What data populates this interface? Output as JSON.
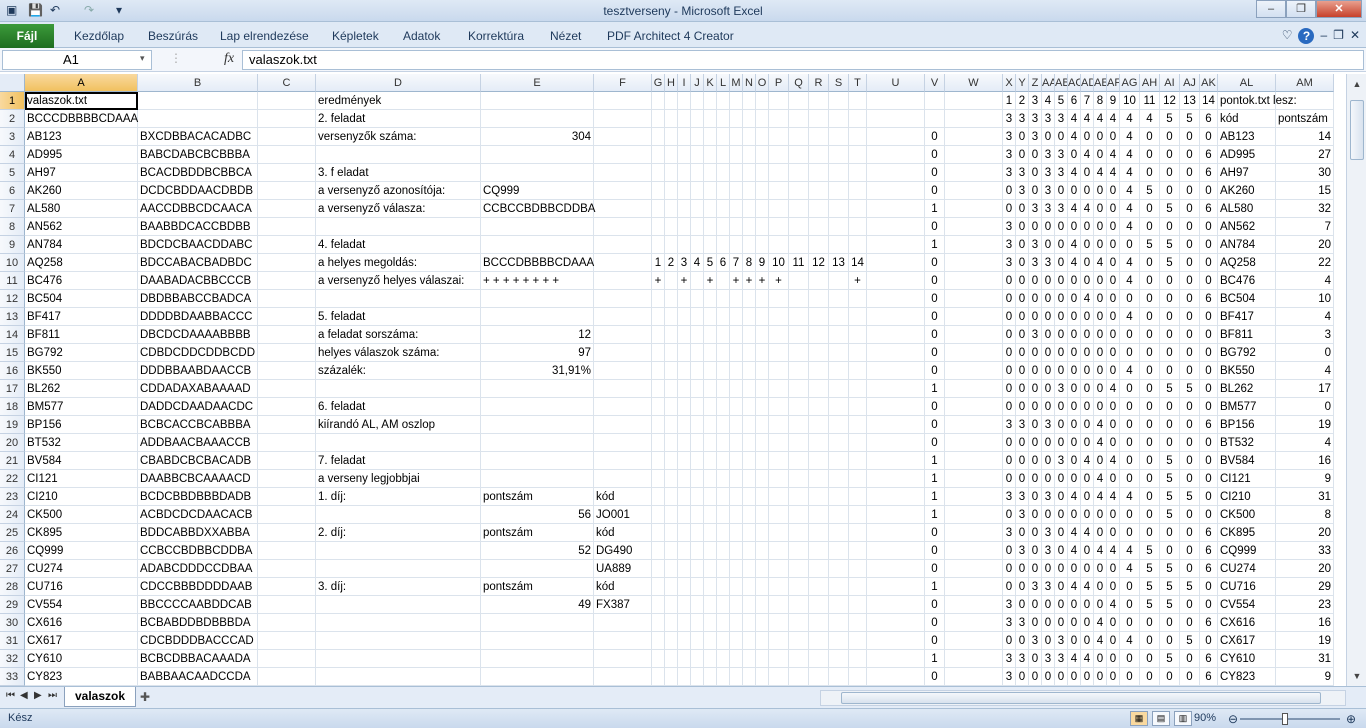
{
  "window": {
    "title": "tesztverseny  -  Microsoft Excel",
    "controls": [
      "–",
      "❐",
      "✕"
    ]
  },
  "ribbon": {
    "file_tab": "Fájl",
    "tabs": [
      "Kezdőlap",
      "Beszúrás",
      "Lap elrendezése",
      "Képletek",
      "Adatok",
      "Korrektúra",
      "Nézet",
      "PDF Architect 4 Creator"
    ]
  },
  "formula_bar": {
    "name_box": "A1",
    "fx_label": "fx",
    "content": "valaszok.txt"
  },
  "columns": [
    "A",
    "B",
    "C",
    "D",
    "E",
    "F",
    "G",
    "H",
    "I",
    "J",
    "K",
    "L",
    "M",
    "N",
    "O",
    "P",
    "Q",
    "R",
    "S",
    "T",
    "U",
    "V",
    "W",
    "X",
    "Y",
    "Z",
    "AA",
    "AB",
    "AC",
    "AD",
    "AE",
    "AF",
    "AG",
    "AH",
    "AI",
    "AJ",
    "AK",
    "AL",
    "AM"
  ],
  "rows": [
    {
      "n": 1,
      "A": "valaszok.txt",
      "D": "eredmények",
      "X": "1",
      "Y": "2",
      "Z": "3",
      "AA": "4",
      "AB": "5",
      "AC": "6",
      "AD": "7",
      "AE": "8",
      "AF": "9",
      "AG": "10",
      "AH": "11",
      "AI": "12",
      "AJ": "13",
      "AK": "14",
      "AL": "pontok.txt lesz:"
    },
    {
      "n": 2,
      "A": "BCCCDBBBBCDAAA",
      "D": "2. feladat",
      "X": "3",
      "Y": "3",
      "Z": "3",
      "AA": "3",
      "AB": "3",
      "AC": "4",
      "AD": "4",
      "AE": "4",
      "AF": "4",
      "AG": "4",
      "AH": "4",
      "AI": "5",
      "AJ": "5",
      "AK": "6",
      "AL": "kód",
      "AM": "pontszám"
    },
    {
      "n": 3,
      "A": "AB123",
      "B": "BXCDBBACACADBC",
      "D": "versenyzők száma:",
      "E": "304",
      "V": "0",
      "X": "3",
      "Y": "0",
      "Z": "3",
      "AA": "0",
      "AB": "0",
      "AC": "4",
      "AD": "0",
      "AE": "0",
      "AF": "0",
      "AG": "4",
      "AH": "0",
      "AI": "0",
      "AJ": "0",
      "AK": "0",
      "AL": "AB123",
      "AM": "14"
    },
    {
      "n": 4,
      "A": "AD995",
      "B": "BABCDABCBCBBBA",
      "V": "0",
      "X": "3",
      "Y": "0",
      "Z": "0",
      "AA": "3",
      "AB": "3",
      "AC": "0",
      "AD": "4",
      "AE": "0",
      "AF": "4",
      "AG": "4",
      "AH": "0",
      "AI": "0",
      "AJ": "0",
      "AK": "6",
      "AL": "AD995",
      "AM": "27"
    },
    {
      "n": 5,
      "A": "AH97",
      "B": "BCACDBDDBCBBCA",
      "D": "3. f eladat",
      "V": "0",
      "X": "3",
      "Y": "3",
      "Z": "0",
      "AA": "3",
      "AB": "3",
      "AC": "4",
      "AD": "0",
      "AE": "4",
      "AF": "4",
      "AG": "4",
      "AH": "0",
      "AI": "0",
      "AJ": "0",
      "AK": "6",
      "AL": "AH97",
      "AM": "30"
    },
    {
      "n": 6,
      "A": "AK260",
      "B": "DCDCBDDAACDBDB",
      "D": "a versenyző azonosítója:",
      "E": "CQ999",
      "V": "0",
      "X": "0",
      "Y": "3",
      "Z": "0",
      "AA": "3",
      "AB": "0",
      "AC": "0",
      "AD": "0",
      "AE": "0",
      "AF": "0",
      "AG": "4",
      "AH": "5",
      "AI": "0",
      "AJ": "0",
      "AK": "0",
      "AL": "AK260",
      "AM": "15"
    },
    {
      "n": 7,
      "A": "AL580",
      "B": "AACCDBBCDCAACA",
      "D": "a versenyző válasza:",
      "E": "CCBCCBDBBCDDBA",
      "V": "1",
      "X": "0",
      "Y": "0",
      "Z": "3",
      "AA": "3",
      "AB": "3",
      "AC": "4",
      "AD": "4",
      "AE": "0",
      "AF": "0",
      "AG": "4",
      "AH": "0",
      "AI": "5",
      "AJ": "0",
      "AK": "6",
      "AL": "AL580",
      "AM": "32"
    },
    {
      "n": 8,
      "A": "AN562",
      "B": "BAABBDCACCBDBB",
      "V": "0",
      "X": "3",
      "Y": "0",
      "Z": "0",
      "AA": "0",
      "AB": "0",
      "AC": "0",
      "AD": "0",
      "AE": "0",
      "AF": "0",
      "AG": "4",
      "AH": "0",
      "AI": "0",
      "AJ": "0",
      "AK": "0",
      "AL": "AN562",
      "AM": "7"
    },
    {
      "n": 9,
      "A": "AN784",
      "B": "BDCDCBAACDDABC",
      "D": "4. feladat",
      "V": "1",
      "X": "3",
      "Y": "0",
      "Z": "3",
      "AA": "0",
      "AB": "0",
      "AC": "4",
      "AD": "0",
      "AE": "0",
      "AF": "0",
      "AG": "0",
      "AH": "5",
      "AI": "5",
      "AJ": "0",
      "AK": "0",
      "AL": "AN784",
      "AM": "20"
    },
    {
      "n": 10,
      "A": "AQ258",
      "B": "BDCCABACBADBDC",
      "D": "a helyes megoldás:",
      "E": "BCCCDBBBBCDAAA",
      "G": "1",
      "H": "2",
      "I": "3",
      "J": "4",
      "K": "5",
      "L": "6",
      "M": "7",
      "N": "8",
      "O": "9",
      "P": "10",
      "Q": "11",
      "R": "12",
      "S": "13",
      "T": "14",
      "V": "0",
      "X": "3",
      "Y": "0",
      "Z": "3",
      "AA": "3",
      "AB": "0",
      "AC": "4",
      "AD": "0",
      "AE": "4",
      "AF": "0",
      "AG": "4",
      "AH": "0",
      "AI": "5",
      "AJ": "0",
      "AK": "0",
      "AL": "AQ258",
      "AM": "22"
    },
    {
      "n": 11,
      "A": "BC476",
      "B": "DAABADACBBCCCB",
      "D": "a versenyző helyes válaszai:",
      "E": " + + + + + + +   +",
      "G": "+",
      "I": "+",
      "K": "+",
      "M": "+",
      "N": "+",
      "O": "+",
      "P": "+",
      "T": "+",
      "V": "0",
      "X": "0",
      "Y": "0",
      "Z": "0",
      "AA": "0",
      "AB": "0",
      "AC": "0",
      "AD": "0",
      "AE": "0",
      "AF": "0",
      "AG": "4",
      "AH": "0",
      "AI": "0",
      "AJ": "0",
      "AK": "0",
      "AL": "BC476",
      "AM": "4"
    },
    {
      "n": 12,
      "A": "BC504",
      "B": "DBDBBABCCBADCA",
      "V": "0",
      "X": "0",
      "Y": "0",
      "Z": "0",
      "AA": "0",
      "AB": "0",
      "AC": "0",
      "AD": "4",
      "AE": "0",
      "AF": "0",
      "AG": "0",
      "AH": "0",
      "AI": "0",
      "AJ": "0",
      "AK": "6",
      "AL": "BC504",
      "AM": "10"
    },
    {
      "n": 13,
      "A": "BF417",
      "B": "DDDDBDAABBACCC",
      "D": "5. feladat",
      "V": "0",
      "X": "0",
      "Y": "0",
      "Z": "0",
      "AA": "0",
      "AB": "0",
      "AC": "0",
      "AD": "0",
      "AE": "0",
      "AF": "0",
      "AG": "4",
      "AH": "0",
      "AI": "0",
      "AJ": "0",
      "AK": "0",
      "AL": "BF417",
      "AM": "4"
    },
    {
      "n": 14,
      "A": "BF811",
      "B": "DBCDCDAAAABBBB",
      "D": "a feladat sorszáma:",
      "E": "12",
      "V": "0",
      "X": "0",
      "Y": "0",
      "Z": "3",
      "AA": "0",
      "AB": "0",
      "AC": "0",
      "AD": "0",
      "AE": "0",
      "AF": "0",
      "AG": "0",
      "AH": "0",
      "AI": "0",
      "AJ": "0",
      "AK": "0",
      "AL": "BF811",
      "AM": "3"
    },
    {
      "n": 15,
      "A": "BG792",
      "B": "CDBDCDDCDDBCDD",
      "D": "helyes válaszok száma:",
      "E": "97",
      "V": "0",
      "X": "0",
      "Y": "0",
      "Z": "0",
      "AA": "0",
      "AB": "0",
      "AC": "0",
      "AD": "0",
      "AE": "0",
      "AF": "0",
      "AG": "0",
      "AH": "0",
      "AI": "0",
      "AJ": "0",
      "AK": "0",
      "AL": "BG792",
      "AM": "0"
    },
    {
      "n": 16,
      "A": "BK550",
      "B": "DDDBBAABDAACCB",
      "D": "százalék:",
      "E": "31,91%",
      "V": "0",
      "X": "0",
      "Y": "0",
      "Z": "0",
      "AA": "0",
      "AB": "0",
      "AC": "0",
      "AD": "0",
      "AE": "0",
      "AF": "0",
      "AG": "4",
      "AH": "0",
      "AI": "0",
      "AJ": "0",
      "AK": "0",
      "AL": "BK550",
      "AM": "4"
    },
    {
      "n": 17,
      "A": "BL262",
      "B": "CDDADAXABAAAAD",
      "V": "1",
      "X": "0",
      "Y": "0",
      "Z": "0",
      "AA": "0",
      "AB": "3",
      "AC": "0",
      "AD": "0",
      "AE": "0",
      "AF": "4",
      "AG": "0",
      "AH": "0",
      "AI": "5",
      "AJ": "5",
      "AK": "0",
      "AL": "BL262",
      "AM": "17"
    },
    {
      "n": 18,
      "A": "BM577",
      "B": "DADDCDAADAACDC",
      "D": "6. feladat",
      "V": "0",
      "X": "0",
      "Y": "0",
      "Z": "0",
      "AA": "0",
      "AB": "0",
      "AC": "0",
      "AD": "0",
      "AE": "0",
      "AF": "0",
      "AG": "0",
      "AH": "0",
      "AI": "0",
      "AJ": "0",
      "AK": "0",
      "AL": "BM577",
      "AM": "0"
    },
    {
      "n": 19,
      "A": "BP156",
      "B": "BCBCACCBCABBBA",
      "D": "kiírandó AL, AM oszlop",
      "V": "0",
      "X": "3",
      "Y": "3",
      "Z": "0",
      "AA": "3",
      "AB": "0",
      "AC": "0",
      "AD": "0",
      "AE": "4",
      "AF": "0",
      "AG": "0",
      "AH": "0",
      "AI": "0",
      "AJ": "0",
      "AK": "6",
      "AL": "BP156",
      "AM": "19"
    },
    {
      "n": 20,
      "A": "BT532",
      "B": "ADDBAACBAAACCB",
      "V": "0",
      "X": "0",
      "Y": "0",
      "Z": "0",
      "AA": "0",
      "AB": "0",
      "AC": "0",
      "AD": "0",
      "AE": "4",
      "AF": "0",
      "AG": "0",
      "AH": "0",
      "AI": "0",
      "AJ": "0",
      "AK": "0",
      "AL": "BT532",
      "AM": "4"
    },
    {
      "n": 21,
      "A": "BV584",
      "B": "CBABDCBCBACADB",
      "D": "7. feladat",
      "V": "1",
      "X": "0",
      "Y": "0",
      "Z": "0",
      "AA": "0",
      "AB": "3",
      "AC": "0",
      "AD": "4",
      "AE": "0",
      "AF": "4",
      "AG": "0",
      "AH": "0",
      "AI": "5",
      "AJ": "0",
      "AK": "0",
      "AL": "BV584",
      "AM": "16"
    },
    {
      "n": 22,
      "A": "CI121",
      "B": "DAABBCBCAAAACD",
      "D": "a verseny legjobbjai",
      "V": "1",
      "X": "0",
      "Y": "0",
      "Z": "0",
      "AA": "0",
      "AB": "0",
      "AC": "0",
      "AD": "0",
      "AE": "4",
      "AF": "0",
      "AG": "0",
      "AH": "0",
      "AI": "5",
      "AJ": "0",
      "AK": "0",
      "AL": "CI121",
      "AM": "9"
    },
    {
      "n": 23,
      "A": "CI210",
      "B": "BCDCBBDBBBDADB",
      "D": "1. díj:",
      "E": "pontszám",
      "F": "kód",
      "V": "1",
      "X": "3",
      "Y": "3",
      "Z": "0",
      "AA": "3",
      "AB": "0",
      "AC": "4",
      "AD": "0",
      "AE": "4",
      "AF": "4",
      "AG": "4",
      "AH": "0",
      "AI": "5",
      "AJ": "5",
      "AK": "0",
      "AL": "CI210",
      "AM": "31"
    },
    {
      "n": 24,
      "A": "CK500",
      "B": "ACBDCDCDAACACB",
      "E": "56",
      "F": "JO001",
      "V": "1",
      "X": "0",
      "Y": "3",
      "Z": "0",
      "AA": "0",
      "AB": "0",
      "AC": "0",
      "AD": "0",
      "AE": "0",
      "AF": "0",
      "AG": "0",
      "AH": "0",
      "AI": "5",
      "AJ": "0",
      "AK": "0",
      "AL": "CK500",
      "AM": "8"
    },
    {
      "n": 25,
      "A": "CK895",
      "B": "BDDCABBDXXABBA",
      "D": "2. díj:",
      "E": "pontszám",
      "F": "kód",
      "V": "0",
      "X": "3",
      "Y": "0",
      "Z": "0",
      "AA": "3",
      "AB": "0",
      "AC": "4",
      "AD": "4",
      "AE": "0",
      "AF": "0",
      "AG": "0",
      "AH": "0",
      "AI": "0",
      "AJ": "0",
      "AK": "6",
      "AL": "CK895",
      "AM": "20"
    },
    {
      "n": 26,
      "A": "CQ999",
      "B": "CCBCCBDBBCDDBA",
      "E": "52",
      "F": "DG490",
      "V": "0",
      "X": "0",
      "Y": "3",
      "Z": "0",
      "AA": "3",
      "AB": "0",
      "AC": "4",
      "AD": "0",
      "AE": "4",
      "AF": "4",
      "AG": "4",
      "AH": "5",
      "AI": "0",
      "AJ": "0",
      "AK": "6",
      "AL": "CQ999",
      "AM": "33"
    },
    {
      "n": 27,
      "A": "CU274",
      "B": "ADABCDDDCCDBAA",
      "F": "UA889",
      "V": "0",
      "X": "0",
      "Y": "0",
      "Z": "0",
      "AA": "0",
      "AB": "0",
      "AC": "0",
      "AD": "0",
      "AE": "0",
      "AF": "0",
      "AG": "4",
      "AH": "5",
      "AI": "5",
      "AJ": "0",
      "AK": "6",
      "AL": "CU274",
      "AM": "20"
    },
    {
      "n": 28,
      "A": "CU716",
      "B": "CDCCBBBDDDDAAB",
      "D": "3. díj:",
      "E": "pontszám",
      "F": "kód",
      "V": "1",
      "X": "0",
      "Y": "0",
      "Z": "3",
      "AA": "3",
      "AB": "0",
      "AC": "4",
      "AD": "4",
      "AE": "0",
      "AF": "0",
      "AG": "0",
      "AH": "5",
      "AI": "5",
      "AJ": "5",
      "AK": "0",
      "AL": "CU716",
      "AM": "29"
    },
    {
      "n": 29,
      "A": "CV554",
      "B": "BBCCCCAABDDCAB",
      "E": "49",
      "F": "FX387",
      "V": "0",
      "X": "3",
      "Y": "0",
      "Z": "0",
      "AA": "0",
      "AB": "0",
      "AC": "0",
      "AD": "0",
      "AE": "0",
      "AF": "4",
      "AG": "0",
      "AH": "5",
      "AI": "5",
      "AJ": "0",
      "AK": "0",
      "AL": "CV554",
      "AM": "23"
    },
    {
      "n": 30,
      "A": "CX616",
      "B": "BCBABDDBDBBBDA",
      "V": "0",
      "X": "3",
      "Y": "3",
      "Z": "0",
      "AA": "0",
      "AB": "0",
      "AC": "0",
      "AD": "0",
      "AE": "4",
      "AF": "0",
      "AG": "0",
      "AH": "0",
      "AI": "0",
      "AJ": "0",
      "AK": "6",
      "AL": "CX616",
      "AM": "16"
    },
    {
      "n": 31,
      "A": "CX617",
      "B": "CDCBDDDBACCCAD",
      "V": "0",
      "X": "0",
      "Y": "0",
      "Z": "3",
      "AA": "0",
      "AB": "3",
      "AC": "0",
      "AD": "0",
      "AE": "4",
      "AF": "0",
      "AG": "4",
      "AH": "0",
      "AI": "0",
      "AJ": "5",
      "AK": "0",
      "AL": "CX617",
      "AM": "19"
    },
    {
      "n": 32,
      "A": "CY610",
      "B": "BCBCDBBACAAADA",
      "V": "1",
      "X": "3",
      "Y": "3",
      "Z": "0",
      "AA": "3",
      "AB": "3",
      "AC": "4",
      "AD": "4",
      "AE": "0",
      "AF": "0",
      "AG": "0",
      "AH": "0",
      "AI": "5",
      "AJ": "0",
      "AK": "6",
      "AL": "CY610",
      "AM": "31"
    },
    {
      "n": 33,
      "A": "CY823",
      "B": "BABBAACAADCCDA",
      "V": "0",
      "X": "3",
      "Y": "0",
      "Z": "0",
      "AA": "0",
      "AB": "0",
      "AC": "0",
      "AD": "0",
      "AE": "0",
      "AF": "0",
      "AG": "0",
      "AH": "0",
      "AI": "0",
      "AJ": "0",
      "AK": "6",
      "AL": "CY823",
      "AM": "9"
    }
  ],
  "sheet_tabs": {
    "active": "valaszok"
  },
  "status": {
    "mode": "Kész",
    "zoom": "90%",
    "zoom_fraction": 0.45
  },
  "colors": {
    "accent": "#1e6d20",
    "selection": "#f1c15f",
    "header": "#e4ecf7"
  }
}
